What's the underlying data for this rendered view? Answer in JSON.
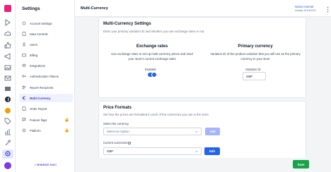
{
  "header": {
    "page_title": "Multi-Currency",
    "store_name": "Nosto Internal",
    "store_id": "shopify-161162229"
  },
  "sidebar": {
    "title": "Settings",
    "items": [
      {
        "label": "Account Settings",
        "icon": "gear-icon"
      },
      {
        "label": "Data Controls",
        "icon": "database-icon"
      },
      {
        "label": "Users",
        "icon": "user-icon"
      },
      {
        "label": "Billing",
        "icon": "credit-card-icon"
      },
      {
        "label": "Integrations",
        "icon": "plug-icon"
      },
      {
        "label": "Authentication Tokens",
        "icon": "key-icon"
      },
      {
        "label": "Report Recipients",
        "icon": "users-icon"
      },
      {
        "label": "Multi-Currency",
        "icon": "euro-icon",
        "active": true
      },
      {
        "label": "Order Report",
        "icon": "document-icon"
      },
      {
        "label": "Feature flags",
        "icon": "flag-icon",
        "locked": true
      },
      {
        "label": "Platform",
        "icon": "settings-icon",
        "locked": true
      }
    ],
    "minimize_label": "< MINIMIZE NAVI"
  },
  "multi_currency_settings": {
    "title": "Multi-Currency Settings",
    "subtitle": "Enter your primary variation ID and whether you use exchange rates or not.",
    "exchange_rates": {
      "heading": "Exchange rates",
      "description": "Use exchange rates to set up multi-currency prices and send your store's current exchange rates",
      "toggle_label": "Enabled",
      "enabled": true
    },
    "primary_currency": {
      "heading": "Primary currency",
      "description": "Variation ID of the product variation that you will use as the primary currency in your store",
      "field_label": "Variation ID",
      "field_value": "GBP"
    }
  },
  "price_formats": {
    "title": "Price Formats",
    "subtitle": "Set how the prices are formatted in each of the currencies you use in the store.",
    "select_label": "Select the currency",
    "select_placeholder": "Select an Option",
    "add_label": "Add",
    "current_label": "Current currencies",
    "current_value": "GBP",
    "edit_label": "Edit"
  },
  "footer": {
    "save_label": "Save"
  },
  "colors": {
    "accent": "#2563eb",
    "brand": "#ec1e7a",
    "save": "#16a34a"
  }
}
